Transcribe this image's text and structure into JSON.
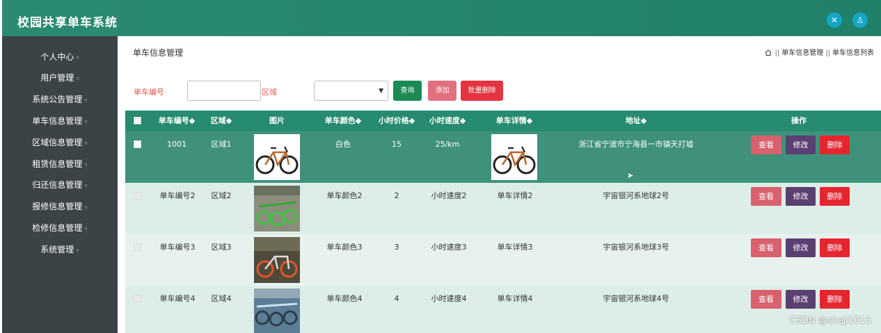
{
  "app": {
    "title": "校园共享单车系统"
  },
  "topbar": {
    "icons": [
      {
        "name": "expand-icon",
        "glyph": "✕"
      },
      {
        "name": "user-icon",
        "glyph": "♙"
      }
    ]
  },
  "sidebar": {
    "items": [
      {
        "label": "个人中心"
      },
      {
        "label": "用户管理"
      },
      {
        "label": "系统公告管理"
      },
      {
        "label": "单车信息管理"
      },
      {
        "label": "区域信息管理"
      },
      {
        "label": "租赁信息管理"
      },
      {
        "label": "归还信息管理"
      },
      {
        "label": "报修信息管理"
      },
      {
        "label": "检修信息管理"
      },
      {
        "label": "系统管理"
      }
    ]
  },
  "page": {
    "title": "单车信息管理",
    "breadcrumb": {
      "sep": "||",
      "level1": "单车信息管理",
      "level2": "单车信息列表"
    }
  },
  "search": {
    "bike_no_label": "单车编号",
    "bike_no_value": "",
    "area_label": "区域",
    "area_value": "",
    "query_label": "查询",
    "add_label": "添加",
    "batch_delete_label": "批量删除"
  },
  "table": {
    "headers": [
      "单车编号◆",
      "区域◆",
      "图片",
      "单车颜色◆",
      "小时价格◆",
      "小时速度◆",
      "单车详情◆",
      "地址◆",
      "操作"
    ],
    "actions": {
      "view": "查看",
      "edit": "修改",
      "delete": "删除"
    },
    "rows": [
      {
        "no": "1001",
        "area": "区域1",
        "color": "白色",
        "price": "15",
        "speed": "25/km",
        "address": "浙江省宁波市宁海县一市镇天打墟",
        "image": "white-bike",
        "detail_image": "white-bike"
      },
      {
        "no": "单车编号2",
        "area": "区域2",
        "color": "单车颜色2",
        "price": "2",
        "speed": "小时速度2",
        "detail": "单车详情2",
        "address": "宇宙银河系地球2号",
        "image": "green-bikes"
      },
      {
        "no": "单车编号3",
        "area": "区域3",
        "color": "单车颜色3",
        "price": "3",
        "speed": "小时速度3",
        "detail": "单车详情3",
        "address": "宇宙银河系地球3号",
        "image": "orange-bike"
      },
      {
        "no": "单车编号4",
        "area": "区域4",
        "color": "单车颜色4",
        "price": "4",
        "speed": "小时速度4",
        "detail": "单车详情4",
        "address": "宇宙银河系地球4号",
        "image": "blue-bikes"
      }
    ]
  },
  "watermark": "CSDN @sheji1015",
  "colors": {
    "header": "#268b70",
    "sidebar": "#3b4347",
    "query_btn": "#1b8a55",
    "add_btn": "#e0707e",
    "batch_delete_btn": "#e53340",
    "view_btn": "#d9606d",
    "edit_btn": "#5b3f72",
    "delete_btn": "#e6262f"
  }
}
